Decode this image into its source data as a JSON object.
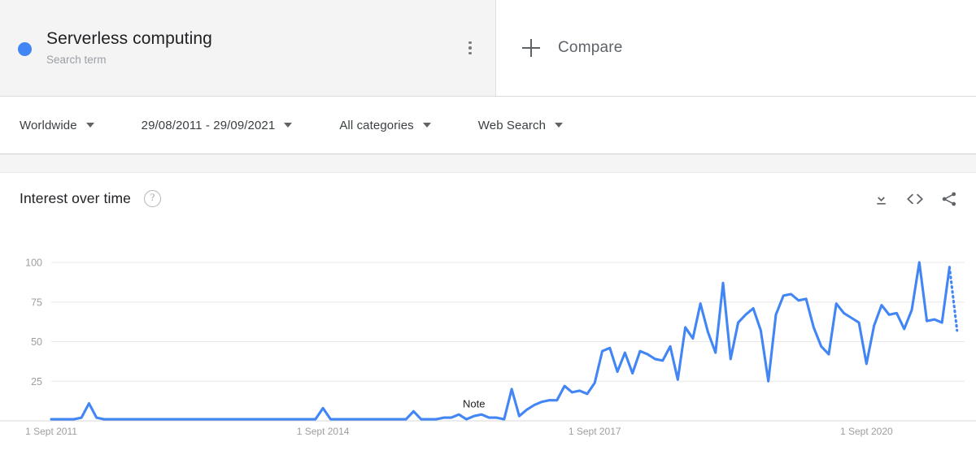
{
  "search_card": {
    "term": "Serverless computing",
    "type_label": "Search term",
    "dot_color": "#4285f4",
    "menu_icon": "kebab-menu-icon"
  },
  "compare": {
    "label": "Compare",
    "icon": "plus-icon"
  },
  "filters": [
    {
      "label": "Worldwide",
      "name": "region"
    },
    {
      "label": "29/08/2011 - 29/09/2021",
      "name": "time-range"
    },
    {
      "label": "All categories",
      "name": "category"
    },
    {
      "label": "Web Search",
      "name": "search-type"
    }
  ],
  "chart_card": {
    "title": "Interest over time",
    "help_icon": "?",
    "actions": [
      {
        "name": "download-icon",
        "title": "Download CSV"
      },
      {
        "name": "embed-code-icon",
        "title": "Embed"
      },
      {
        "name": "share-icon",
        "title": "Share"
      }
    ]
  },
  "chart_data": {
    "type": "line",
    "title": "Interest over time",
    "xlabel": "",
    "ylabel": "",
    "ylim": [
      0,
      100
    ],
    "yticks": [
      25,
      50,
      75,
      100
    ],
    "grid": true,
    "legend": false,
    "line_color": "#4285f4",
    "x_tick_labels": [
      "1 Sept 2011",
      "1 Sept 2014",
      "1 Sept 2017",
      "1 Sept 2020"
    ],
    "x_tick_positions": [
      0,
      36,
      72,
      108
    ],
    "x_range": [
      0,
      121
    ],
    "annotation": {
      "text": "Note",
      "x": 56,
      "y": 6
    },
    "partial_from_index": 119,
    "series": [
      {
        "name": "Serverless computing",
        "values": [
          1,
          1,
          1,
          1,
          2,
          11,
          2,
          1,
          1,
          1,
          1,
          1,
          1,
          1,
          1,
          1,
          1,
          1,
          1,
          1,
          1,
          1,
          1,
          1,
          1,
          1,
          1,
          1,
          1,
          1,
          1,
          1,
          1,
          1,
          1,
          1,
          8,
          1,
          1,
          1,
          1,
          1,
          1,
          1,
          1,
          1,
          1,
          1,
          6,
          1,
          1,
          1,
          2,
          2,
          4,
          1,
          3,
          4,
          2,
          2,
          1,
          20,
          3,
          7,
          10,
          12,
          13,
          13,
          22,
          18,
          19,
          17,
          24,
          44,
          46,
          31,
          43,
          30,
          44,
          42,
          39,
          38,
          47,
          26,
          59,
          52,
          74,
          56,
          43,
          87,
          39,
          62,
          67,
          71,
          57,
          25,
          67,
          79,
          80,
          76,
          77,
          59,
          47,
          42,
          74,
          68,
          65,
          62,
          36,
          60,
          73,
          67,
          68,
          58,
          70,
          100,
          63,
          64,
          62,
          97,
          57
        ]
      }
    ]
  }
}
